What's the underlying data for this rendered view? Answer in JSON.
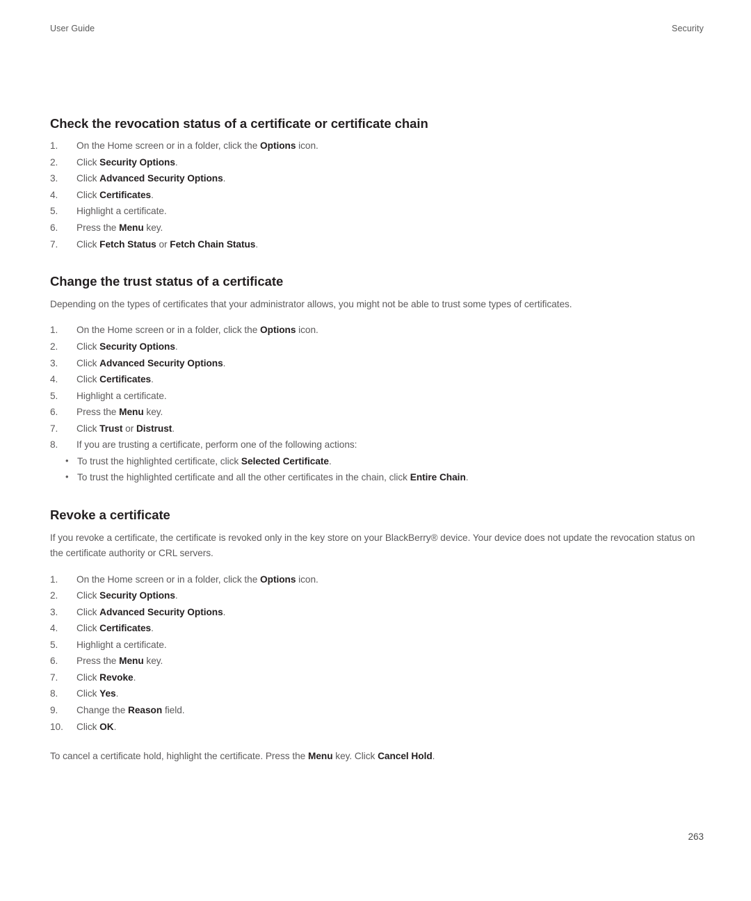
{
  "header": {
    "left": "User Guide",
    "right": "Security"
  },
  "sections": [
    {
      "title": "Check the revocation status of a certificate or certificate chain",
      "intro": null,
      "steps": [
        {
          "num": "1.",
          "parts": [
            {
              "t": "On the Home screen or in a folder, click the ",
              "b": false
            },
            {
              "t": "Options",
              "b": true
            },
            {
              "t": " icon.",
              "b": false
            }
          ]
        },
        {
          "num": "2.",
          "parts": [
            {
              "t": "Click ",
              "b": false
            },
            {
              "t": "Security Options",
              "b": true
            },
            {
              "t": ".",
              "b": false
            }
          ]
        },
        {
          "num": "3.",
          "parts": [
            {
              "t": "Click ",
              "b": false
            },
            {
              "t": "Advanced Security Options",
              "b": true
            },
            {
              "t": ".",
              "b": false
            }
          ]
        },
        {
          "num": "4.",
          "parts": [
            {
              "t": "Click ",
              "b": false
            },
            {
              "t": "Certificates",
              "b": true
            },
            {
              "t": ".",
              "b": false
            }
          ]
        },
        {
          "num": "5.",
          "parts": [
            {
              "t": "Highlight a certificate.",
              "b": false
            }
          ]
        },
        {
          "num": "6.",
          "parts": [
            {
              "t": "Press the ",
              "b": false
            },
            {
              "t": "Menu",
              "b": true
            },
            {
              "t": " key.",
              "b": false
            }
          ]
        },
        {
          "num": "7.",
          "parts": [
            {
              "t": "Click ",
              "b": false
            },
            {
              "t": "Fetch Status",
              "b": true
            },
            {
              "t": " or ",
              "b": false
            },
            {
              "t": "Fetch Chain Status",
              "b": true
            },
            {
              "t": ".",
              "b": false
            }
          ]
        }
      ]
    },
    {
      "title": "Change the trust status of a certificate",
      "intro": "Depending on the types of certificates that your administrator allows, you might not be able to trust some types of certificates.",
      "steps": [
        {
          "num": "1.",
          "parts": [
            {
              "t": "On the Home screen or in a folder, click the ",
              "b": false
            },
            {
              "t": "Options",
              "b": true
            },
            {
              "t": " icon.",
              "b": false
            }
          ]
        },
        {
          "num": "2.",
          "parts": [
            {
              "t": "Click ",
              "b": false
            },
            {
              "t": "Security Options",
              "b": true
            },
            {
              "t": ".",
              "b": false
            }
          ]
        },
        {
          "num": "3.",
          "parts": [
            {
              "t": "Click ",
              "b": false
            },
            {
              "t": "Advanced Security Options",
              "b": true
            },
            {
              "t": ".",
              "b": false
            }
          ]
        },
        {
          "num": "4.",
          "parts": [
            {
              "t": "Click ",
              "b": false
            },
            {
              "t": "Certificates",
              "b": true
            },
            {
              "t": ".",
              "b": false
            }
          ]
        },
        {
          "num": "5.",
          "parts": [
            {
              "t": "Highlight a certificate.",
              "b": false
            }
          ]
        },
        {
          "num": "6.",
          "parts": [
            {
              "t": "Press the ",
              "b": false
            },
            {
              "t": "Menu",
              "b": true
            },
            {
              "t": " key.",
              "b": false
            }
          ]
        },
        {
          "num": "7.",
          "parts": [
            {
              "t": "Click ",
              "b": false
            },
            {
              "t": "Trust",
              "b": true
            },
            {
              "t": " or ",
              "b": false
            },
            {
              "t": "Distrust",
              "b": true
            },
            {
              "t": ".",
              "b": false
            }
          ]
        },
        {
          "num": "8.",
          "parts": [
            {
              "t": "If you are trusting a certificate, perform one of the following actions:",
              "b": false
            }
          ],
          "bullets": [
            {
              "dot": "•",
              "parts": [
                {
                  "t": "To trust the highlighted certificate, click ",
                  "b": false
                },
                {
                  "t": "Selected Certificate",
                  "b": true
                },
                {
                  "t": ".",
                  "b": false
                }
              ]
            },
            {
              "dot": "•",
              "parts": [
                {
                  "t": "To trust the highlighted certificate and all the other certificates in the chain, click ",
                  "b": false
                },
                {
                  "t": "Entire Chain",
                  "b": true
                },
                {
                  "t": ".",
                  "b": false
                }
              ]
            }
          ]
        }
      ]
    },
    {
      "title": "Revoke a certificate",
      "intro": "If you revoke a certificate, the certificate is revoked only in the key store on your BlackBerry® device. Your device does not update the revocation status on the certificate authority or CRL servers.",
      "steps": [
        {
          "num": "1.",
          "parts": [
            {
              "t": "On the Home screen or in a folder, click the ",
              "b": false
            },
            {
              "t": "Options",
              "b": true
            },
            {
              "t": " icon.",
              "b": false
            }
          ]
        },
        {
          "num": "2.",
          "parts": [
            {
              "t": "Click ",
              "b": false
            },
            {
              "t": "Security Options",
              "b": true
            },
            {
              "t": ".",
              "b": false
            }
          ]
        },
        {
          "num": "3.",
          "parts": [
            {
              "t": "Click ",
              "b": false
            },
            {
              "t": "Advanced Security Options",
              "b": true
            },
            {
              "t": ".",
              "b": false
            }
          ]
        },
        {
          "num": "4.",
          "parts": [
            {
              "t": "Click ",
              "b": false
            },
            {
              "t": "Certificates",
              "b": true
            },
            {
              "t": ".",
              "b": false
            }
          ]
        },
        {
          "num": "5.",
          "parts": [
            {
              "t": "Highlight a certificate.",
              "b": false
            }
          ]
        },
        {
          "num": "6.",
          "parts": [
            {
              "t": "Press the ",
              "b": false
            },
            {
              "t": "Menu",
              "b": true
            },
            {
              "t": " key.",
              "b": false
            }
          ]
        },
        {
          "num": "7.",
          "parts": [
            {
              "t": "Click ",
              "b": false
            },
            {
              "t": "Revoke",
              "b": true
            },
            {
              "t": ".",
              "b": false
            }
          ]
        },
        {
          "num": "8.",
          "parts": [
            {
              "t": "Click ",
              "b": false
            },
            {
              "t": "Yes",
              "b": true
            },
            {
              "t": ".",
              "b": false
            }
          ]
        },
        {
          "num": "9.",
          "parts": [
            {
              "t": "Change the ",
              "b": false
            },
            {
              "t": "Reason",
              "b": true
            },
            {
              "t": " field.",
              "b": false
            }
          ]
        },
        {
          "num": "10.",
          "parts": [
            {
              "t": "Click ",
              "b": false
            },
            {
              "t": "OK",
              "b": true
            },
            {
              "t": ".",
              "b": false
            }
          ]
        }
      ],
      "trailing": [
        {
          "t": "To cancel a certificate hold, highlight the certificate. Press the ",
          "b": false
        },
        {
          "t": "Menu",
          "b": true
        },
        {
          "t": " key. Click ",
          "b": false
        },
        {
          "t": "Cancel Hold",
          "b": true
        },
        {
          "t": ".",
          "b": false
        }
      ]
    }
  ],
  "folio": "263",
  "colors": {
    "body_text": "#5c5a5b",
    "heading_text": "#231f20",
    "header_text": "#5a5a5a",
    "page_background": "#ffffff"
  }
}
